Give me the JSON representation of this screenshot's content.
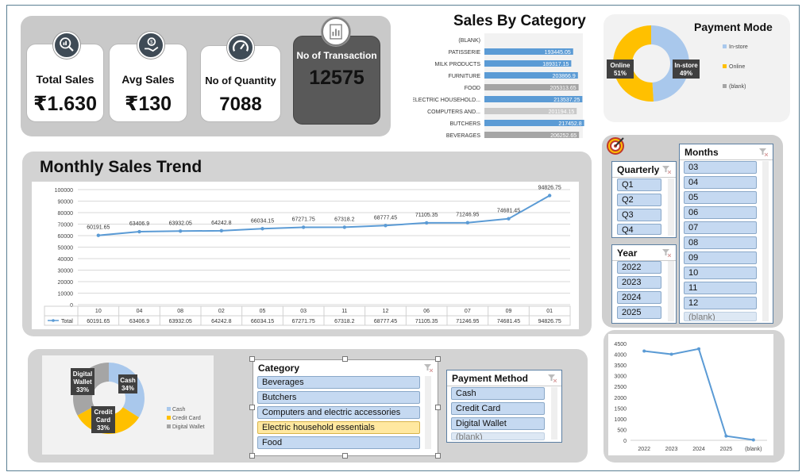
{
  "kpis": {
    "total_sales": {
      "label": "Total Sales",
      "value": "₹1.630"
    },
    "avg_sales": {
      "label": "Avg Sales",
      "value": "₹130"
    },
    "quantity": {
      "label": "No of Quantity",
      "value": "7088"
    },
    "transactions": {
      "label": "No of Transaction",
      "value": "12575"
    }
  },
  "icons": {
    "total_sales": "magnifier-chart-icon",
    "avg_sales": "hand-money-icon",
    "quantity": "speedometer-icon",
    "transactions": "document-chart-icon",
    "target": "target-icon",
    "filter": "filter-clear-icon"
  },
  "colors": {
    "accent_blue": "#6a9fd8",
    "line_blue": "#5b9bd5",
    "orange": "#ffc000",
    "gray": "#a5a5a5",
    "light_blue": "#a9c8ec"
  },
  "category_chart": {
    "title": "Sales By Category",
    "chart_data": {
      "type": "bar",
      "orientation": "horizontal",
      "categories": [
        "(BLANK)",
        "PATISSERIE",
        "MILK PRODUCTS",
        "FURNITURE",
        "FOOD",
        "ELECTRIC HOUSEHOLD...",
        "COMPUTERS AND...",
        "BUTCHERS",
        "BEVERAGES"
      ],
      "values": [
        0,
        193445.05,
        189317.15,
        203866.9,
        205313.65,
        213537.25,
        201194.15,
        217452.8,
        206252.65
      ],
      "labels": [
        "",
        "193445.05",
        "189317.15",
        "203866.9",
        "205313.65",
        "213537.25",
        "201194.15",
        "217452.8",
        "206252.65"
      ],
      "bar_colors": [
        "#5b9bd5",
        "#5b9bd5",
        "#5b9bd5",
        "#5b9bd5",
        "#a5a5a5",
        "#5b9bd5",
        "#c9c9c9",
        "#5b9bd5",
        "#a5a5a5"
      ]
    }
  },
  "payment_mode_chart": {
    "title": "Payment Mode",
    "chart_data": {
      "type": "pie",
      "donut": true,
      "slices": [
        {
          "name": "In-store",
          "value": 49,
          "label": "In-store",
          "pct": "49%",
          "color": "#a9c8ec"
        },
        {
          "name": "Online",
          "value": 51,
          "label": "Online",
          "pct": "51%",
          "color": "#ffc000"
        }
      ],
      "legend": [
        "In-store",
        "Online",
        "(blank)"
      ],
      "legend_colors": [
        "#a9c8ec",
        "#ffc000",
        "#a5a5a5"
      ],
      "legend_position": "right"
    }
  },
  "monthly_trend": {
    "title": "Monthly Sales Trend",
    "chart_data": {
      "type": "line",
      "categories": [
        "10",
        "04",
        "08",
        "02",
        "05",
        "03",
        "11",
        "12",
        "06",
        "07",
        "09",
        "01"
      ],
      "values": [
        60191.65,
        63406.9,
        63932.05,
        64242.8,
        66034.15,
        67271.75,
        67318.2,
        68777.45,
        71105.35,
        71246.95,
        74681.45,
        94826.75
      ],
      "labels": [
        "60191.65",
        "63406.9",
        "63932.05",
        "64242.8",
        "66034.15",
        "67271.75",
        "67318.2",
        "68777.45",
        "71105.35",
        "71246.95",
        "74681.45",
        "94826.75"
      ],
      "table_labels": [
        "60191.65",
        "63406.9",
        "63932.05",
        "64242.8",
        "66034.15",
        "67271.75",
        "67318.2",
        "68777.45",
        "71105.35",
        "71246.95",
        "74681.45",
        "94826.75"
      ],
      "series_name": "Total",
      "yticks": [
        "100000",
        "90000",
        "80000",
        "70000",
        "60000",
        "50000",
        "40000",
        "30000",
        "20000",
        "10000",
        "0"
      ],
      "ylim": [
        0,
        100000
      ],
      "grid": true
    }
  },
  "payment_method_chart": {
    "chart_data": {
      "type": "pie",
      "donut": true,
      "slices": [
        {
          "name": "Cash",
          "value": 34,
          "label": "Cash",
          "pct": "34%",
          "color": "#a9c8ec"
        },
        {
          "name": "Credit Card",
          "value": 33,
          "label": "Credit Card",
          "pct": "33%",
          "color": "#ffc000"
        },
        {
          "name": "Digital Wallet",
          "value": 33,
          "label": "Digital Wallet",
          "pct": "33%",
          "color": "#a5a5a5"
        }
      ],
      "legend": [
        "Cash",
        "Credit Card",
        "Digital Wallet"
      ],
      "legend_position": "bottom-right"
    }
  },
  "year_trend": {
    "chart_data": {
      "type": "line",
      "categories": [
        "2022",
        "2023",
        "2024",
        "2025",
        "(blank)"
      ],
      "values": [
        4150,
        4000,
        4250,
        200,
        20
      ],
      "yticks": [
        "4500",
        "4000",
        "3500",
        "3000",
        "2500",
        "2000",
        "1500",
        "1000",
        "500",
        "0"
      ],
      "ylim": [
        0,
        4500
      ],
      "grid": false
    }
  },
  "slicers": {
    "quarterly": {
      "title": "Quarterly",
      "items": [
        "Q1",
        "Q2",
        "Q3",
        "Q4"
      ]
    },
    "months": {
      "title": "Months",
      "items": [
        "03",
        "04",
        "05",
        "06",
        "07",
        "08",
        "09",
        "10",
        "11",
        "12",
        "(blank)"
      ]
    },
    "year": {
      "title": "Year",
      "items": [
        "2022",
        "2023",
        "2024",
        "2025"
      ]
    },
    "category": {
      "title": "Category",
      "items": [
        "Beverages",
        "Butchers",
        "Computers and electric accessories",
        "Electric household essentials",
        "Food"
      ],
      "selected_index": 3
    },
    "payment_method": {
      "title": "Payment Method",
      "items": [
        "Cash",
        "Credit Card",
        "Digital Wallet",
        "(blank)"
      ]
    }
  }
}
